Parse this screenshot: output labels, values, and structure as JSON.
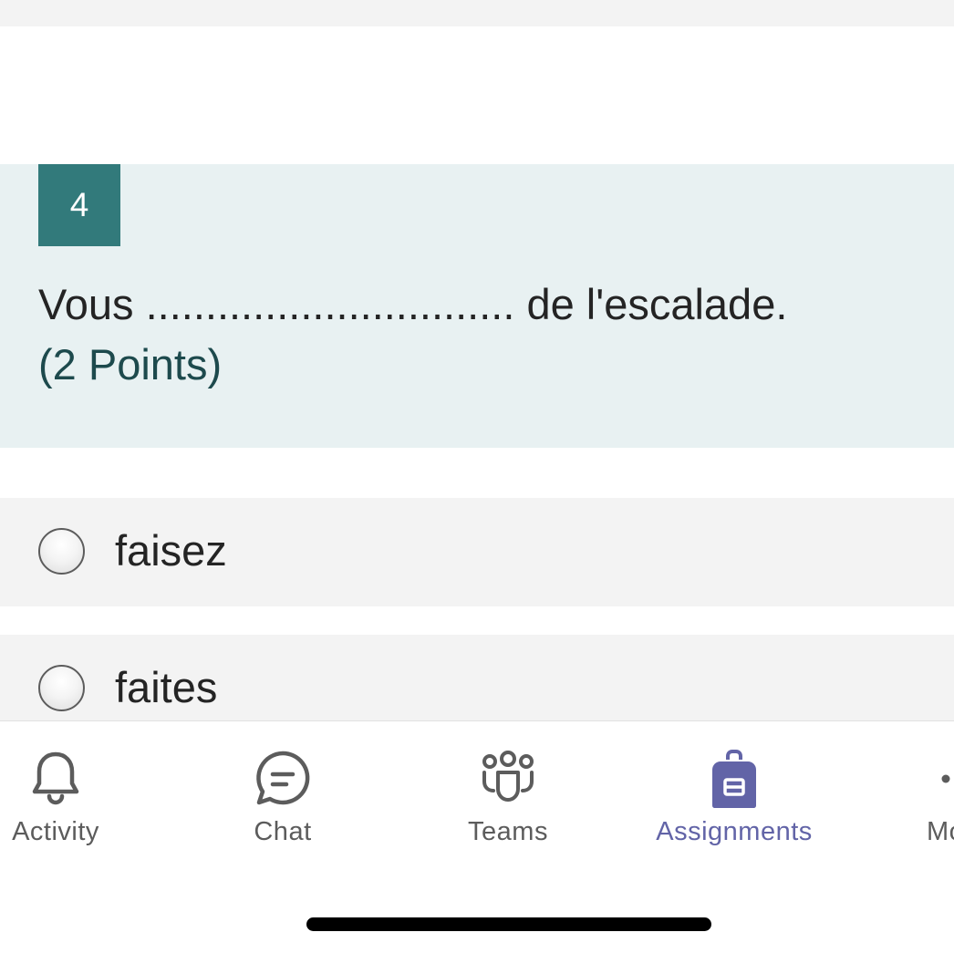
{
  "question": {
    "number": "4",
    "text": "Vous ............................... de l'escalade.",
    "points": "(2 Points)"
  },
  "options": [
    {
      "label": "faisez",
      "selected": false
    },
    {
      "label": "faites",
      "selected": false
    }
  ],
  "tabs": {
    "activity": {
      "label": "Activity",
      "icon": "bell-icon"
    },
    "chat": {
      "label": "Chat",
      "icon": "chat-bubble-icon"
    },
    "teams": {
      "label": "Teams",
      "icon": "teams-icon"
    },
    "assignments": {
      "label": "Assignments",
      "icon": "backpack-icon",
      "active": true
    },
    "more": {
      "label": "Mo",
      "icon": "more-icon"
    }
  },
  "colors": {
    "accent": "#6264a7",
    "question_badge": "#327a7b",
    "question_bg": "#e8f1f2",
    "points_text": "#1d4a4d"
  }
}
